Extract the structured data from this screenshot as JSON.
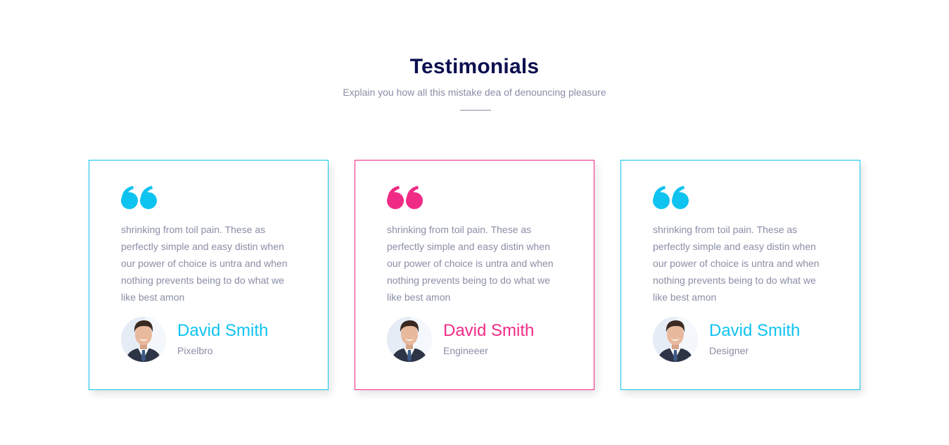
{
  "header": {
    "title": "Testimonials",
    "subtitle": "Explain you how all this mistake dea of denouncing pleasure"
  },
  "colors": {
    "cyan": "#0fc3f0",
    "pink": "#f02b86",
    "heading": "#0c0f4f",
    "muted": "#8a8ea6"
  },
  "testimonials": [
    {
      "quote": "shrinking from toil pain. These as perfectly simple and easy distin when our power of choice is untra and when nothing prevents being to do what we like best amon",
      "name": "David Smith",
      "role": "Pixelbro",
      "accent": "#0fc3f0",
      "icon": "quote-icon"
    },
    {
      "quote": "shrinking from toil pain. These as perfectly simple and easy distin when our power of choice is untra and when nothing prevents being to do what we like best amon",
      "name": "David Smith",
      "role": "Engineeer",
      "accent": "#f02b86",
      "icon": "quote-icon"
    },
    {
      "quote": "shrinking from toil pain. These as perfectly simple and easy distin when our power of choice is untra and when nothing prevents being to do what we like best amon",
      "name": "David Smith",
      "role": "Designer",
      "accent": "#0fc3f0",
      "icon": "quote-icon"
    }
  ]
}
